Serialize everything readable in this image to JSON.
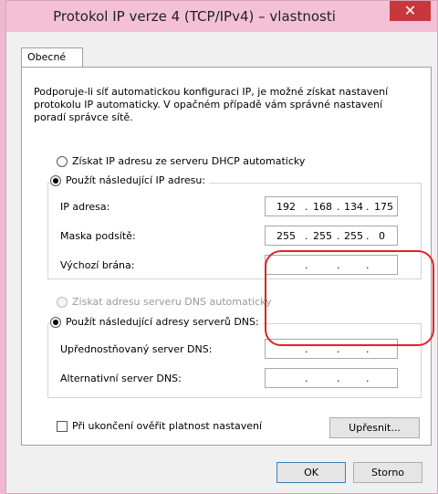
{
  "window": {
    "title": "Protokol IP verze 4 (TCP/IPv4) – vlastnosti",
    "close_glyph": "✕"
  },
  "tab": {
    "label": "Obecné"
  },
  "description": "Podporuje-li síť automatickou konfiguraci IP, je možné získat nastavení protokolu IP automaticky. V opačném případě vám správné nastavení poradí správce sítě.",
  "ip_section": {
    "auto_label": "Získat IP adresu ze serveru DHCP automaticky",
    "manual_label": "Použít následující IP adresu:",
    "fields": [
      {
        "label": "IP adresa:",
        "octets": [
          "192",
          "168",
          "134",
          "175"
        ]
      },
      {
        "label": "Maska podsítě:",
        "octets": [
          "255",
          "255",
          "255",
          "0"
        ]
      },
      {
        "label": "Výchozí brána:",
        "octets": [
          "",
          "",
          "",
          ""
        ]
      }
    ]
  },
  "dns_section": {
    "auto_label": "Získat adresu serveru DNS automaticky",
    "manual_label": "Použít následující adresy serverů DNS:",
    "fields": [
      {
        "label": "Upřednostňovaný server DNS:",
        "octets": [
          "",
          "",
          "",
          ""
        ]
      },
      {
        "label": "Alternativní server DNS:",
        "octets": [
          "",
          "",
          "",
          ""
        ]
      }
    ]
  },
  "validate_label": "Při ukončení ověřit platnost nastavení",
  "buttons": {
    "advanced": "Upřesnit...",
    "ok": "OK",
    "cancel": "Storno"
  },
  "ip_separator": "."
}
